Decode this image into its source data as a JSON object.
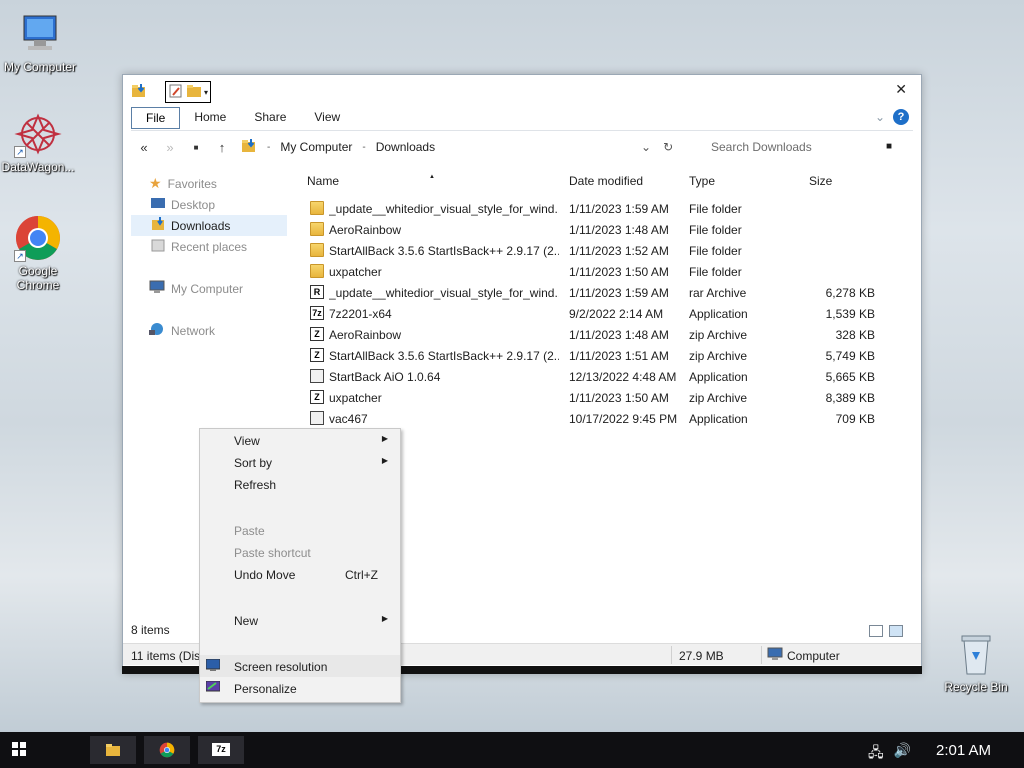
{
  "desktop": {
    "icons": [
      {
        "label": "My Computer"
      },
      {
        "label": "DataWagon..."
      },
      {
        "label": "Google Chrome"
      },
      {
        "label": "Recycle Bin"
      }
    ]
  },
  "explorer": {
    "ribbon_tabs": [
      "File",
      "Home",
      "Share",
      "View"
    ],
    "breadcrumb": [
      "My Computer",
      "Downloads"
    ],
    "search_placeholder": "Search Downloads",
    "nav": {
      "favorites": "Favorites",
      "desktop": "Desktop",
      "downloads": "Downloads",
      "recent": "Recent places",
      "my_computer": "My Computer",
      "network": "Network"
    },
    "columns": {
      "name": "Name",
      "date": "Date modified",
      "type": "Type",
      "size": "Size"
    },
    "files": [
      {
        "name": "_update__whitedior_visual_style_for_wind...",
        "date": "1/11/2023 1:59 AM",
        "type": "File folder",
        "size": "",
        "icon": "folder"
      },
      {
        "name": "AeroRainbow",
        "date": "1/11/2023 1:48 AM",
        "type": "File folder",
        "size": "",
        "icon": "folder"
      },
      {
        "name": "StartAllBack 3.5.6 StartIsBack++ 2.9.17 (2....",
        "date": "1/11/2023 1:52 AM",
        "type": "File folder",
        "size": "",
        "icon": "folder"
      },
      {
        "name": "uxpatcher",
        "date": "1/11/2023 1:50 AM",
        "type": "File folder",
        "size": "",
        "icon": "folder"
      },
      {
        "name": "_update__whitedior_visual_style_for_wind...",
        "date": "1/11/2023 1:59 AM",
        "type": "rar Archive",
        "size": "6,278 KB",
        "icon": "rar"
      },
      {
        "name": "7z2201-x64",
        "date": "9/2/2022 2:14 AM",
        "type": "Application",
        "size": "1,539 KB",
        "icon": "7z"
      },
      {
        "name": "AeroRainbow",
        "date": "1/11/2023 1:48 AM",
        "type": "zip Archive",
        "size": "328 KB",
        "icon": "zip"
      },
      {
        "name": "StartAllBack 3.5.6 StartIsBack++ 2.9.17 (2....",
        "date": "1/11/2023 1:51 AM",
        "type": "zip Archive",
        "size": "5,749 KB",
        "icon": "zip"
      },
      {
        "name": "StartBack AiO 1.0.64",
        "date": "12/13/2022 4:48 AM",
        "type": "Application",
        "size": "5,665 KB",
        "icon": "app"
      },
      {
        "name": "uxpatcher",
        "date": "1/11/2023 1:50 AM",
        "type": "zip Archive",
        "size": "8,389 KB",
        "icon": "zip"
      },
      {
        "name": "vac467",
        "date": "10/17/2022 9:45 PM",
        "type": "Application",
        "size": "709 KB",
        "icon": "app"
      }
    ],
    "item_count": "8 items",
    "statusbar": {
      "left": "11 items (Dis",
      "size": "27.9 MB",
      "location": "Computer"
    }
  },
  "context_menu": {
    "items": [
      {
        "label": "View",
        "submenu": true
      },
      {
        "label": "Sort by",
        "submenu": true
      },
      {
        "label": "Refresh"
      },
      {
        "label": "Paste",
        "disabled": true
      },
      {
        "label": "Paste shortcut",
        "disabled": true
      },
      {
        "label": "Undo Move",
        "shortcut": "Ctrl+Z"
      },
      {
        "label": "New",
        "submenu": true
      },
      {
        "label": "Screen resolution"
      },
      {
        "label": "Personalize"
      }
    ]
  },
  "taskbar": {
    "clock": "2:01 AM"
  },
  "colors": {
    "accent": "#1e6fc8",
    "folder": "#e8b53d",
    "selection": "#e5f0fb"
  }
}
